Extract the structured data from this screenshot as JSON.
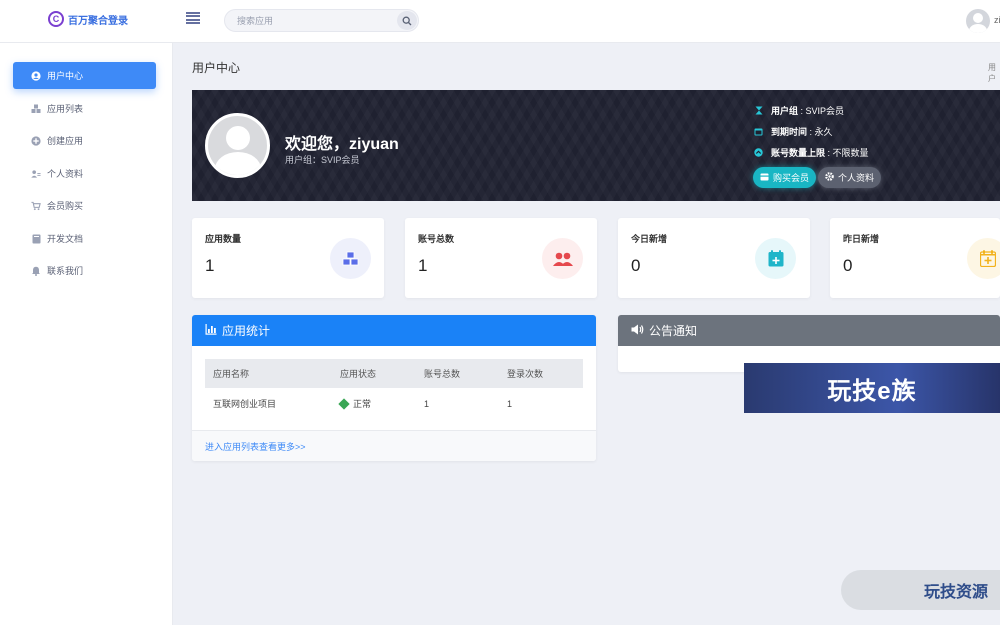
{
  "header": {
    "logo_mark": "C",
    "logo_text": "百万聚合登录",
    "search_placeholder": "搜索应用",
    "user_short": "zi"
  },
  "sidebar": {
    "items": [
      {
        "label": "用户中心",
        "icon": "user-circle-icon",
        "active": true
      },
      {
        "label": "应用列表",
        "icon": "cubes-icon",
        "active": false
      },
      {
        "label": "创建应用",
        "icon": "plus-circle-icon",
        "active": false
      },
      {
        "label": "个人资料",
        "icon": "user-card-icon",
        "active": false
      },
      {
        "label": "会员购买",
        "icon": "cart-icon",
        "active": false
      },
      {
        "label": "开发文档",
        "icon": "book-icon",
        "active": false
      },
      {
        "label": "联系我们",
        "icon": "bell-icon",
        "active": false
      }
    ]
  },
  "page": {
    "title": "用户中心",
    "breadcrumb": "用户"
  },
  "banner": {
    "welcome": "欢迎您，ziyuan",
    "subtitle": "用户组：SVIP会员",
    "info": [
      {
        "label": "用户组",
        "value": "SVIP会员"
      },
      {
        "label": "到期时间",
        "value": "永久"
      },
      {
        "label": "账号数量上限",
        "value": "不限数量"
      }
    ],
    "buy_label": "购买会员",
    "profile_label": "个人资料"
  },
  "stats": [
    {
      "label": "应用数量",
      "value": "1",
      "icon": "cubes-icon",
      "color": "#5b6ee8",
      "bg": "#eef0fb"
    },
    {
      "label": "账号总数",
      "value": "1",
      "icon": "users-icon",
      "color": "#e5484d",
      "bg": "#fdeeee"
    },
    {
      "label": "今日新增",
      "value": "0",
      "icon": "calendar-plus-icon",
      "color": "#1fb5c9",
      "bg": "#e6f7fa"
    },
    {
      "label": "昨日新增",
      "value": "0",
      "icon": "calendar-plus-icon",
      "color": "#f2b21c",
      "bg": "#fdf6e4"
    }
  ],
  "app_panel": {
    "title": "应用统计",
    "columns": [
      "应用名称",
      "应用状态",
      "账号总数",
      "登录次数"
    ],
    "rows": [
      {
        "name": "互联网创业项目",
        "status": "正常",
        "accounts": "1",
        "logins": "1"
      }
    ],
    "footer_link": "进入应用列表查看更多>>",
    "color": "#1a82f7"
  },
  "notice_panel": {
    "title": "公告通知",
    "color": "#6c737d"
  },
  "ads": {
    "banner_text": "玩技e族",
    "corner_text": "玩技资源"
  }
}
